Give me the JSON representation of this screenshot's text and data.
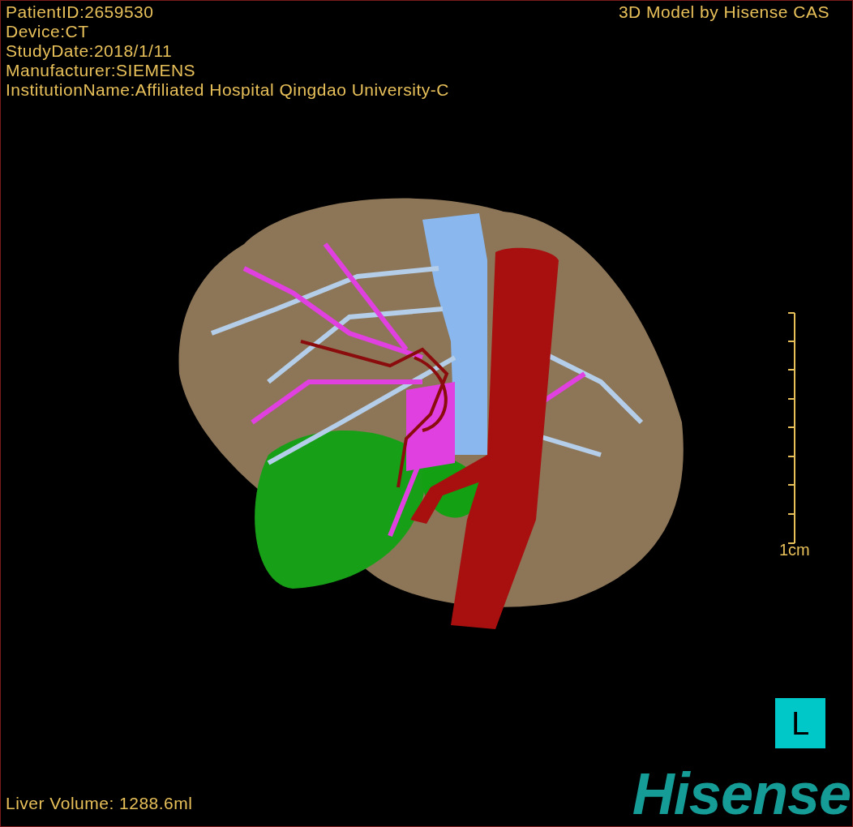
{
  "study_info": [
    "PatientID:2659530",
    "Device:CT",
    "StudyDate:2018/1/11",
    "Manufacturer:SIEMENS",
    "InstitutionName:Affiliated Hospital Qingdao University-C"
  ],
  "header_right": "3D Model by Hisense CAS",
  "scale_bar": {
    "label": "1cm"
  },
  "orientation_marker": "L",
  "liver_volume": "Liver Volume: 1288.6ml",
  "logo": "Hisense"
}
